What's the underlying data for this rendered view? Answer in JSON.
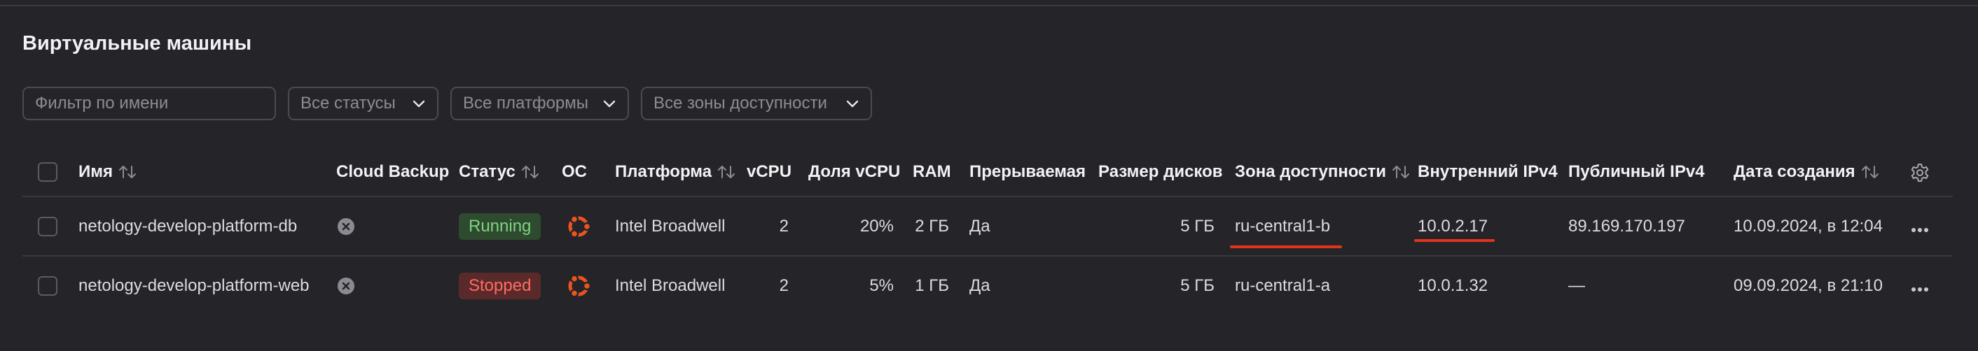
{
  "page": {
    "title": "Виртуальные машины"
  },
  "filters": {
    "name_placeholder": "Фильтр по имени",
    "status": "Все статусы",
    "platform": "Все платформы",
    "zone": "Все зоны доступности"
  },
  "columns": {
    "name": "Имя",
    "cloud_backup": "Cloud Backup",
    "status": "Статус",
    "os": "ОС",
    "platform": "Платформа",
    "vcpu": "vCPU",
    "vcpu_share": "Доля vCPU",
    "ram": "RAM",
    "preemptible": "Прерываемая",
    "disk_size": "Размер дисков",
    "zone": "Зона доступности",
    "internal_ip": "Внутренний IPv4",
    "public_ip": "Публичный IPv4",
    "created": "Дата создания"
  },
  "rows": [
    {
      "name": "netology-develop-platform-db",
      "status": "Running",
      "os_icon": "ubuntu-icon",
      "platform": "Intel Broadwell",
      "vcpu": "2",
      "vcpu_share": "20%",
      "ram": "2 ГБ",
      "preemptible": "Да",
      "disk_size": "5 ГБ",
      "zone": "ru-central1-b",
      "internal_ip": "10.0.2.17",
      "public_ip": "89.169.170.197",
      "created": "10.09.2024, в 12:04"
    },
    {
      "name": "netology-develop-platform-web",
      "status": "Stopped",
      "os_icon": "ubuntu-icon",
      "platform": "Intel Broadwell",
      "vcpu": "2",
      "vcpu_share": "5%",
      "ram": "1 ГБ",
      "preemptible": "Да",
      "disk_size": "5 ГБ",
      "zone": "ru-central1-a",
      "internal_ip": "10.0.1.32",
      "public_ip": "—",
      "created": "09.09.2024, в 21:10"
    }
  ],
  "colors": {
    "background": "#252529",
    "running": "#7fd47f",
    "stopped": "#ff6b62",
    "ubuntu": "#e95420",
    "highlight": "#e2341d"
  }
}
